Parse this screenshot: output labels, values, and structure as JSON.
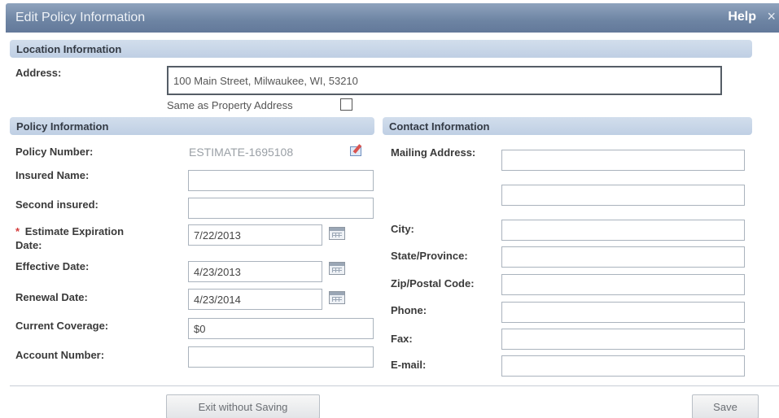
{
  "dialog": {
    "title": "Edit Policy Information",
    "help_label": "Help",
    "close_glyph": "×"
  },
  "location": {
    "section_title": "Location Information",
    "address_label": "Address:",
    "address_value": "100 Main Street, Milwaukee, WI, 53210",
    "same_as_label": "Same as Property Address",
    "same_as_checked": false
  },
  "policy": {
    "section_title": "Policy Information",
    "policy_number_label": "Policy Number:",
    "policy_number_value": "ESTIMATE-1695108",
    "insured_name_label": "Insured Name:",
    "insured_name_value": "",
    "second_insured_label": "Second insured:",
    "second_insured_value": "",
    "required_marker": "*",
    "estimate_expiration_label_line1": "Estimate Expiration",
    "estimate_expiration_label_line2": "Date:",
    "estimate_expiration_value": "7/22/2013",
    "effective_date_label": "Effective Date:",
    "effective_date_value": "4/23/2013",
    "renewal_date_label": "Renewal Date:",
    "renewal_date_value": "4/23/2014",
    "current_coverage_label": "Current Coverage:",
    "current_coverage_value": "$0",
    "account_number_label": "Account Number:",
    "account_number_value": ""
  },
  "contact": {
    "section_title": "Contact Information",
    "mailing_address_label": "Mailing Address:",
    "mailing_address_line1": "",
    "mailing_address_line2": "",
    "city_label": "City:",
    "city_value": "",
    "state_label": "State/Province:",
    "state_value": "",
    "zip_label": "Zip/Postal Code:",
    "zip_value": "",
    "phone_label": "Phone:",
    "phone_value": "",
    "fax_label": "Fax:",
    "fax_value": "",
    "email_label": "E-mail:",
    "email_value": ""
  },
  "footer": {
    "exit_label": "Exit without Saving",
    "save_label": "Save"
  },
  "icons": {
    "edit": "edit-pencil-icon",
    "calendar": "calendar-icon",
    "close": "close-icon"
  },
  "colors": {
    "title_bar": "#6d84a3",
    "section_bar": "#c8d6e8",
    "required": "#d43c3c"
  }
}
